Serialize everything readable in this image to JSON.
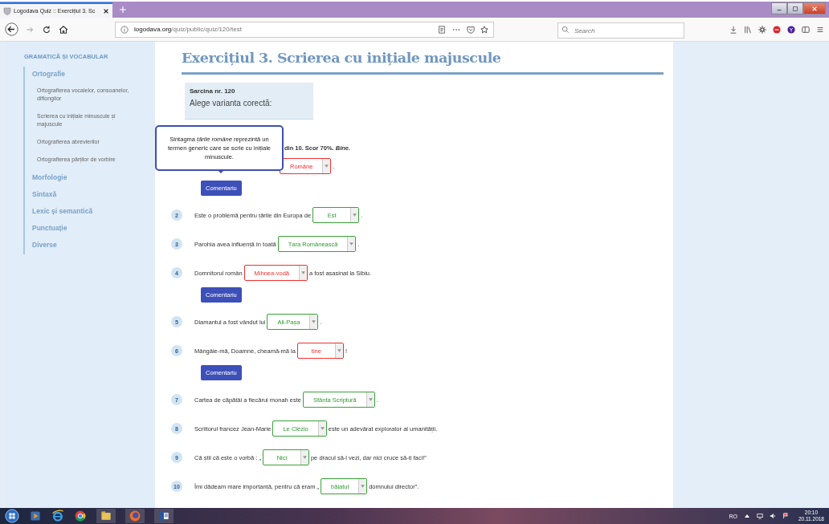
{
  "browser": {
    "tab_title": "Logodava Quiz :: Exercițiul 3. Sc",
    "url_domain": "logodava.org",
    "url_path": "/quiz/public/quiz/120/test",
    "search": {
      "placeholder": "Search"
    }
  },
  "sidebar": {
    "heading": "GRAMATICĂ ȘI VOCABULAR",
    "items": [
      {
        "label": "Ortografie",
        "children": [
          {
            "label": "Ortografierea vocalelor, consoanelor, diftongilor"
          },
          {
            "label": "Scrierea cu inițiale minuscule și majuscule"
          },
          {
            "label": "Ortografierea abrevierilor"
          },
          {
            "label": "Ortografierea părților de vorbire"
          }
        ]
      },
      {
        "label": "Morfologie"
      },
      {
        "label": "Sintaxă"
      },
      {
        "label": "Lexic și semantică"
      },
      {
        "label": "Punctuație"
      },
      {
        "label": "Diverse"
      }
    ]
  },
  "title": "Exercițiul 3. Scrierea cu inițiale majuscule",
  "task": {
    "number_label": "Sarcina nr.  120",
    "instruction": "Alege varianta corectă:"
  },
  "score": "din 10. Scor 70%. *Bine.*",
  "tooltip": "Sintagma *țările române* reprezintă un termen generic care se scrie cu inițiale minuscule.",
  "items": [
    {
      "select": "Române",
      "correct": false,
      "after": ".",
      "comment": "Comentariu"
    },
    {
      "num": "2",
      "before": "Este o problemă pentru țările din Europa de",
      "select": "Est",
      "correct": true,
      "after": "."
    },
    {
      "num": "3",
      "before": "Parohia avea influență în toată",
      "select": "Țara Românească",
      "correct": true,
      "after": "."
    },
    {
      "num": "4",
      "before": "Domnitorul român",
      "select": "Mihnea-vodă",
      "correct": false,
      "after": "a fost asasinat la Sibiu.",
      "comment": "Comentariu"
    },
    {
      "num": "5",
      "before": "Diamantul a fost vândut lui",
      "select": "Ali-Pașa",
      "correct": true,
      "after": "."
    },
    {
      "num": "6",
      "before": "Mângâie-mă, Doamne, cheamă-mă la",
      "select": "tine",
      "correct": false,
      "after": "!",
      "comment": "Comentariu"
    },
    {
      "num": "7",
      "before": "Cartea de căpătâi a fiecărui monah este",
      "select": "Sfânta Scriptură",
      "correct": true,
      "after": "."
    },
    {
      "num": "8",
      "before": "Scriitorul francez Jean-Marie",
      "select": "Le Clézio",
      "correct": true,
      "after": "este un adevărat explorator al umanității."
    },
    {
      "num": "9",
      "before": "Că știi că este o vorbă : „",
      "select": "Nici",
      "correct": true,
      "after": "pe dracul să-l vezi, dar nici cruce să-ți faci!”"
    },
    {
      "num": "10",
      "before": "Îmi dădeam mare importanță, pentru că eram „",
      "select": "băiatul",
      "correct": true,
      "after": "domnului director”."
    }
  ],
  "taskbar": {
    "language": "RO",
    "time": "20:10",
    "date": "20.11.2018"
  }
}
